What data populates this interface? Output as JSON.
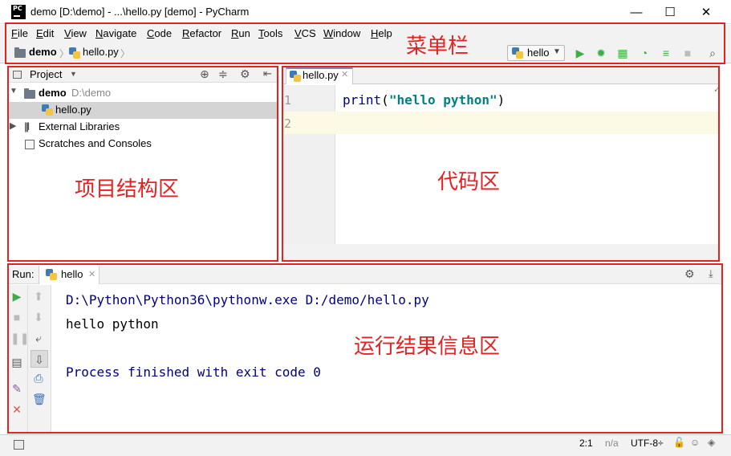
{
  "window": {
    "title": "demo [D:\\demo] - ...\\hello.py [demo] - PyCharm",
    "logo_text": "PC",
    "minimize": "—",
    "maximize": "☐",
    "close": "✕"
  },
  "menu": {
    "items": [
      "File",
      "Edit",
      "View",
      "Navigate",
      "Code",
      "Refactor",
      "Run",
      "Tools",
      "VCS",
      "Window",
      "Help"
    ]
  },
  "navbar": {
    "project": "demo",
    "file": "hello.py",
    "run_config": "hello"
  },
  "project_panel": {
    "title": "Project",
    "tree": {
      "root_name": "demo",
      "root_path": "D:\\demo",
      "file": "hello.py",
      "external_libraries": "External Libraries",
      "scratches": "Scratches and Consoles"
    }
  },
  "editor": {
    "tab_label": "hello.py",
    "line_numbers": [
      "1",
      "2"
    ],
    "code": {
      "func": "print",
      "open": "(",
      "string": "\"hello python\"",
      "close": ")"
    }
  },
  "run_panel": {
    "label": "Run:",
    "tab_label": "hello",
    "console": {
      "command": "D:\\Python\\Python36\\pythonw.exe D:/demo/hello.py",
      "output": "hello python",
      "exit": "Process finished with exit code 0"
    }
  },
  "statusbar": {
    "position": "2:1",
    "line_sep": "n/a",
    "encoding": "UTF-8÷"
  },
  "annotations": {
    "menu_bar": "菜单栏",
    "project_area": "项目结构区",
    "code_area": "代码区",
    "run_area": "运行结果信息区"
  },
  "colors": {
    "annotation_red": "#e32222",
    "keyword_blue": "#000080",
    "string_green": "#008080",
    "run_green": "#3eaf48"
  }
}
